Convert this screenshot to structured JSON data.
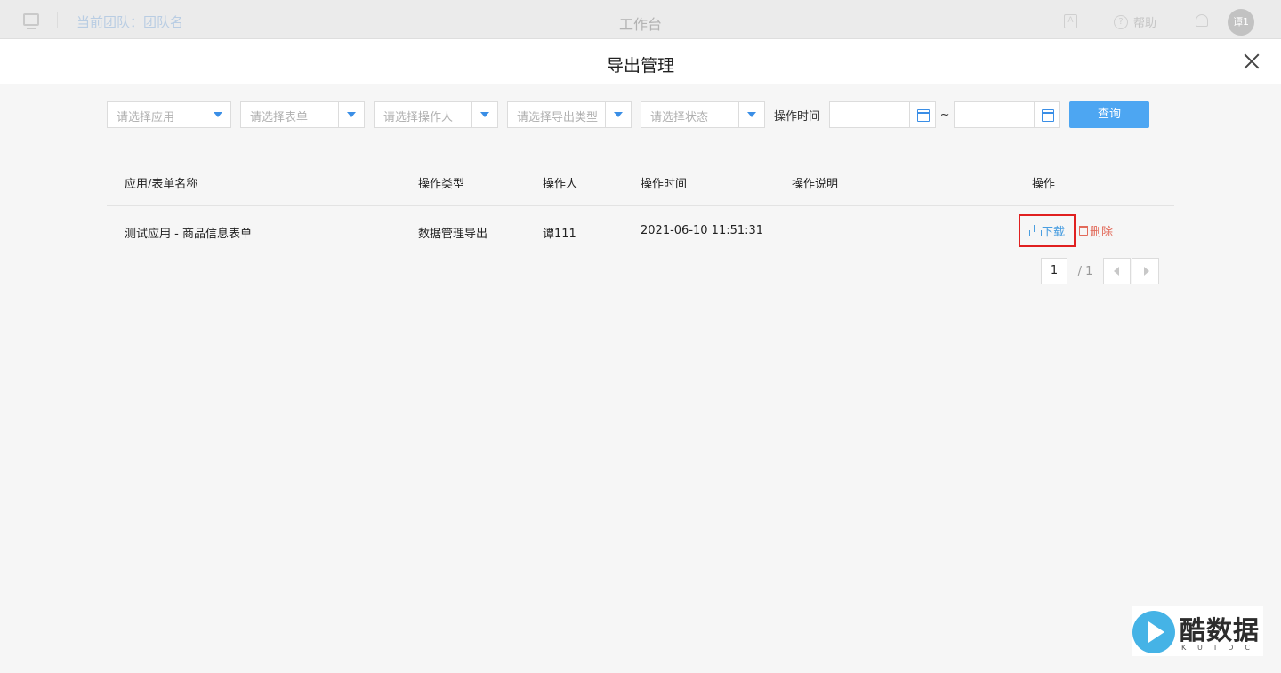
{
  "topbar": {
    "team_label": "当前团队：团队名",
    "title": "工作台",
    "help_label": "帮助",
    "avatar_text": "谭1"
  },
  "modal": {
    "title": "导出管理"
  },
  "filters": {
    "app_placeholder": "请选择应用",
    "form_placeholder": "请选择表单",
    "operator_placeholder": "请选择操作人",
    "export_type_placeholder": "请选择导出类型",
    "status_placeholder": "请选择状态",
    "time_label": "操作时间",
    "range_separator": "~",
    "query_label": "查询"
  },
  "table": {
    "headers": [
      "应用/表单名称",
      "操作类型",
      "操作人",
      "操作时间",
      "操作说明",
      "操作"
    ],
    "rows": [
      {
        "name": "测试应用 - 商品信息表单",
        "type": "数据管理导出",
        "operator": "谭111",
        "time": "2021-06-10 11:51:31",
        "note": "",
        "download_label": "下载",
        "delete_label": "删除"
      }
    ]
  },
  "pagination": {
    "current": "1",
    "total": "/ 1"
  },
  "watermark": {
    "brand": "酷数据",
    "sub": "KUIDC"
  },
  "colors": {
    "accent": "#4da6f2",
    "download": "#4a9ee0",
    "delete": "#e26a5a",
    "highlight_border": "#e02020"
  }
}
